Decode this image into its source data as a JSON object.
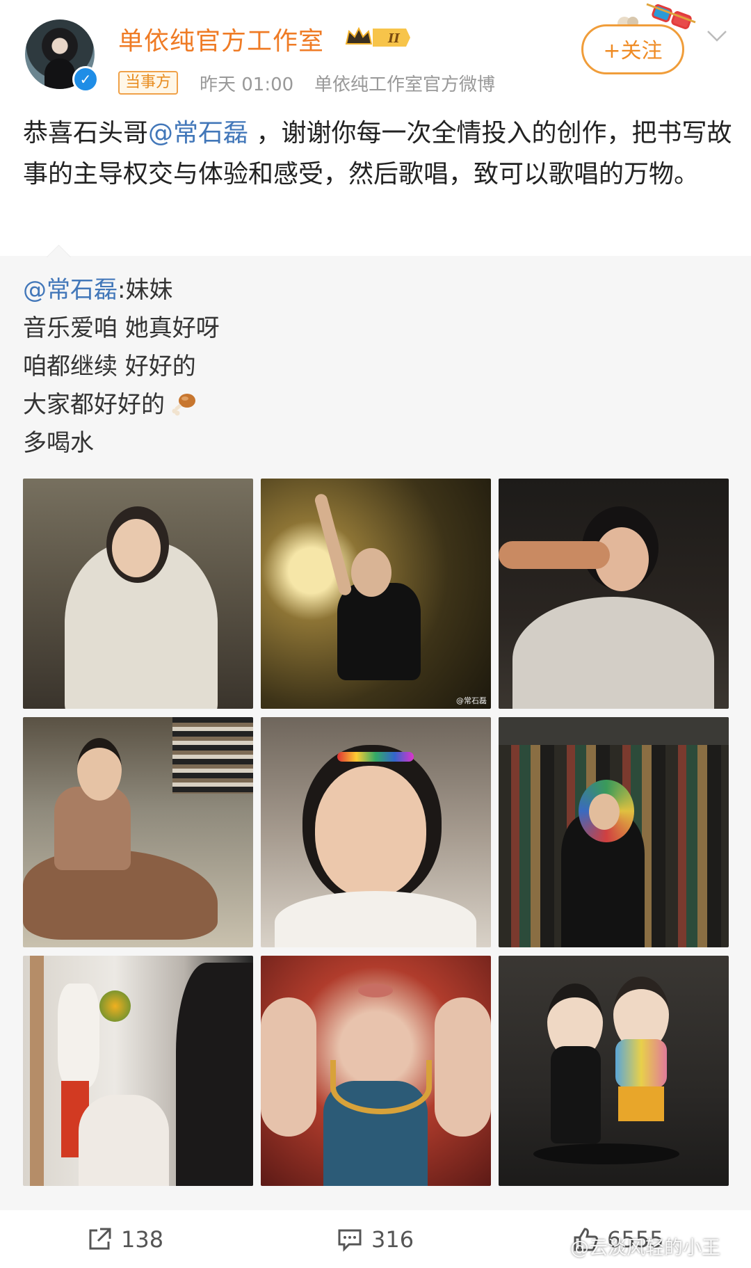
{
  "header": {
    "account_name": "单依纯官方工作室",
    "vip_level": "II",
    "role_tag": "当事方",
    "time": "昨天 01:00",
    "source": "单依纯工作室官方微博",
    "follow_label": "+关注"
  },
  "post": {
    "text_before": "恭喜石头哥",
    "mention": "@常石磊",
    "text_after": " ，谢谢你每一次全情投入的创作，把书写故事的主导权交与体验和感受，然后歌唱，致可以歌唱的万物。"
  },
  "repost": {
    "author_mention": "@常石磊",
    "first_line_text": ":妹妹",
    "lines": [
      "音乐爱咱 她真好呀",
      "咱都继续 好好的",
      "大家都好好的",
      "多喝水"
    ],
    "emoji": "drumstick-emoji"
  },
  "photos": [
    {
      "name": "photo-laughing-hoodie",
      "colors": [
        "#6f6757",
        "#d6d0c3",
        "#332d28"
      ]
    },
    {
      "name": "photo-dancing-lamp",
      "colors": [
        "#4d3f1f",
        "#c7a75a",
        "#1e1a10"
      ]
    },
    {
      "name": "photo-haircut-cape",
      "colors": [
        "#1e1c1a",
        "#cfcac2",
        "#3a2a22"
      ]
    },
    {
      "name": "photo-blanket-floor",
      "colors": [
        "#c8bfa9",
        "#8e6a4f",
        "#4e4a40"
      ]
    },
    {
      "name": "photo-smiling-headband",
      "colors": [
        "#9a8f84",
        "#efe7dc",
        "#2b2420"
      ]
    },
    {
      "name": "photo-closet-scarf",
      "colors": [
        "#2a2a24",
        "#8a6e43",
        "#cdc0a8"
      ]
    },
    {
      "name": "photo-doorway-flowers",
      "colors": [
        "#e4e1dc",
        "#a4522f",
        "#1f1d1c"
      ]
    },
    {
      "name": "photo-necklace-closeup",
      "colors": [
        "#b03c2c",
        "#e9c7b3",
        "#2c5b77"
      ]
    },
    {
      "name": "photo-figurines",
      "colors": [
        "#2c2a28",
        "#e8d5c2",
        "#5b7a9a"
      ]
    }
  ],
  "photo_watermark": "@常石磊",
  "toolbar": {
    "repost_count": "138",
    "comment_count": "316",
    "like_count": "6555"
  },
  "watermark": "@云淡风轻的小王",
  "colors": {
    "name_orange": "#ef7b25",
    "mention_blue": "#4277b9",
    "follow_orange": "#f09d3a"
  }
}
